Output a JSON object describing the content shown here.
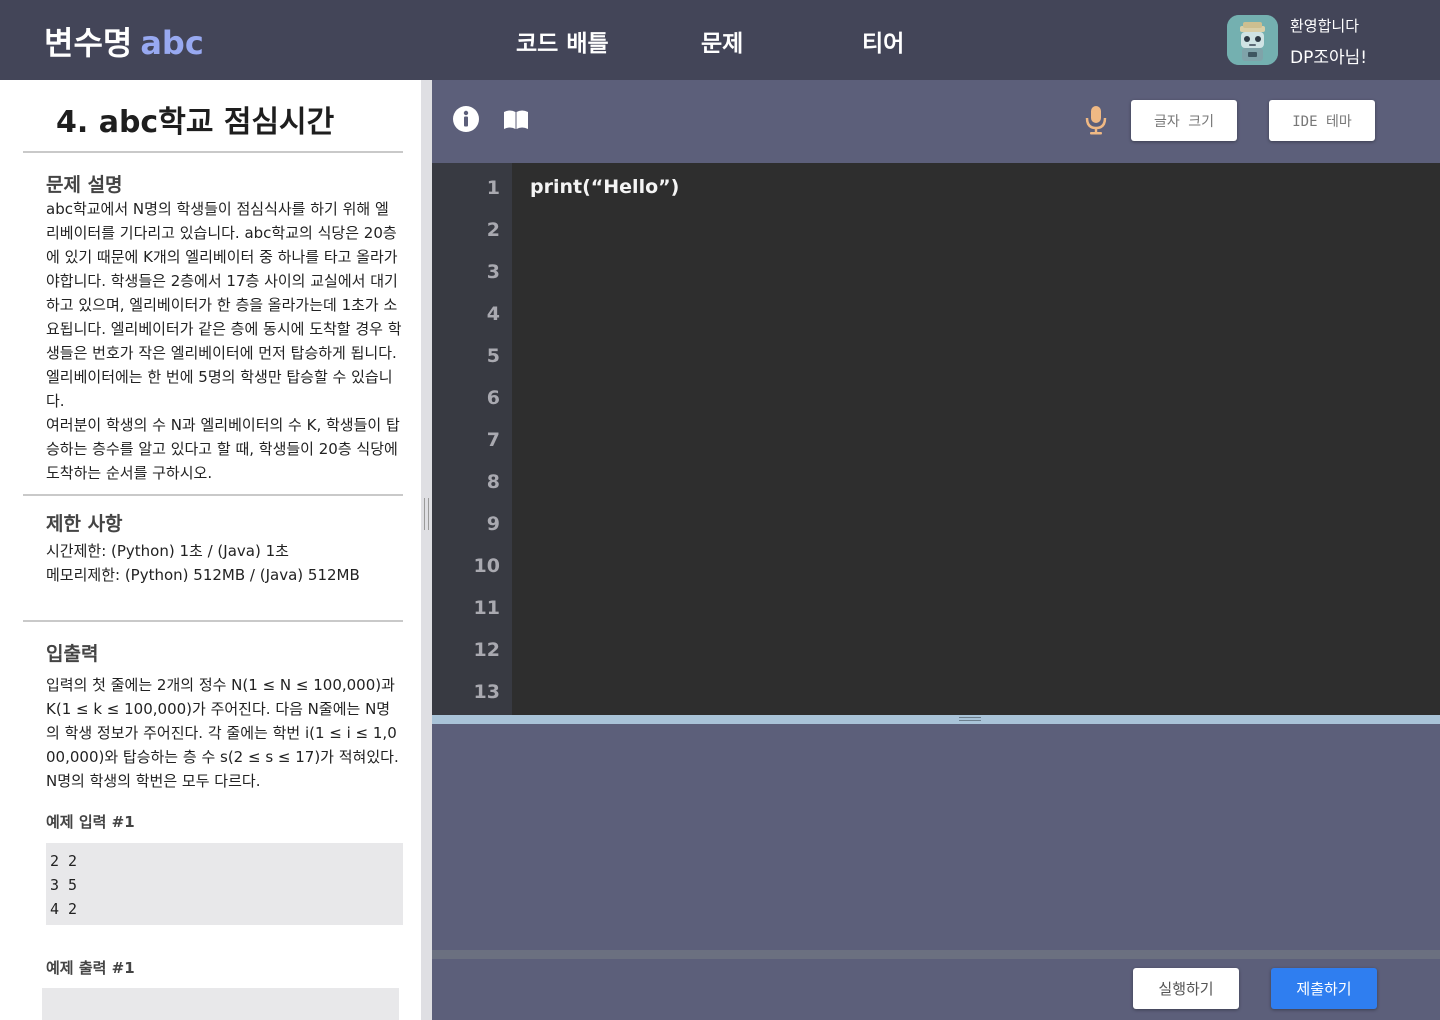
{
  "header": {
    "logo_text": "변수명",
    "logo_accent": "abc",
    "nav": [
      "코드 배틀",
      "문제",
      "티어"
    ],
    "welcome": "환영합니다",
    "username": "DP조아님!"
  },
  "problem": {
    "title": "4. abc학교 점심시간",
    "description_title": "문제 설명",
    "description": "abc학교에서 N명의 학생들이 점심식사를 하기 위해 엘리베이터를 기다리고 있습니다. abc학교의 식당은 20층에 있기 때문에 K개의 엘리베이터 중 하나를 타고 올라가야합니다. 학생들은 2층에서 17층 사이의 교실에서 대기하고 있으며, 엘리베이터가 한 층을 올라가는데 1초가 소요됩니다. 엘리베이터가 같은 층에 동시에 도착할 경우 학생들은 번호가 작은 엘리베이터에 먼저 탑승하게 됩니다. 엘리베이터에는 한 번에 5명의 학생만 탑승할 수 있습니다.\n여러분이 학생의 수 N과 엘리베이터의 수 K, 학생들이 탑승하는 층수를 알고 있다고 할 때, 학생들이 20층 식당에 도착하는 순서를 구하시오.",
    "limits_title": "제한 사항",
    "limits": "시간제한: (Python) 1초 / (Java) 1초\n메모리제한: (Python) 512MB / (Java) 512MB",
    "io_title": "입출력",
    "io": "입력의 첫 줄에는 2개의 정수 N(1 ≤ N ≤ 100,000)과 K(1 ≤ k ≤ 100,000)가 주어진다. 다음 N줄에는 N명의 학생 정보가 주어진다. 각 줄에는 학번 i(1 ≤ i ≤ 1,000,000)와 탑승하는 층 수 s(2 ≤ s ≤ 17)가 적혀있다. N명의 학생의 학번은 모두 다르다.",
    "example_input_title": "예제 입력 #1",
    "example_input": "2 2\n3 5\n4 2",
    "example_output_title": "예제 출력 #1",
    "example_output": ""
  },
  "toolbar": {
    "info_icon": "info-icon",
    "book_icon": "book-icon",
    "mic_icon": "microphone-icon",
    "font_size_label": "글자 크기",
    "theme_label": "IDE 테마"
  },
  "editor": {
    "line_numbers": [
      "1",
      "2",
      "3",
      "4",
      "5",
      "6",
      "7",
      "8",
      "9",
      "10",
      "11",
      "12",
      "13"
    ],
    "code": "print(“Hello”)"
  },
  "footer": {
    "run_label": "실행하기",
    "submit_label": "제출하기"
  },
  "colors": {
    "header_bg": "#434558",
    "accent": "#98a9f1",
    "panel_bg": "#5c5f7a",
    "editor_bg": "#2e2e2e",
    "submit": "#2f7ef0",
    "mic": "#f0b984"
  }
}
